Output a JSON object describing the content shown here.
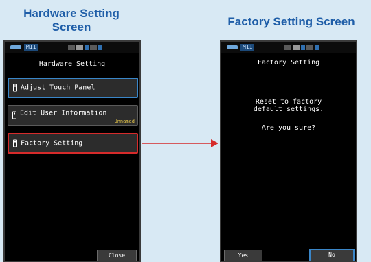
{
  "captions": {
    "left_line1": "Hardware Setting",
    "left_line2": "Screen",
    "right": "Factory Setting Screen"
  },
  "statusbar": {
    "memory": "M11"
  },
  "hardware_screen": {
    "title": "Hardware Setting",
    "items": [
      {
        "label": "Adjust Touch Panel",
        "sublabel": "",
        "border_color": "#3a86c8"
      },
      {
        "label": "Edit User Information",
        "sublabel": "Unnamed",
        "border_color": "#5a5a5a"
      },
      {
        "label": "Factory Setting",
        "sublabel": "",
        "border_color": "#d62b2b"
      }
    ],
    "close_label": "Close"
  },
  "factory_screen": {
    "title": "Factory Setting",
    "message_line1": "Reset to factory",
    "message_line2": "default settings.",
    "question": "Are you sure?",
    "yes_label": "Yes",
    "no_label": "No"
  },
  "colors": {
    "background": "#d8e9f4",
    "caption": "#1f5ea8",
    "arrow": "#d62b2b",
    "highlight_blue": "#3a86c8",
    "sublabel": "#e6c64a"
  }
}
